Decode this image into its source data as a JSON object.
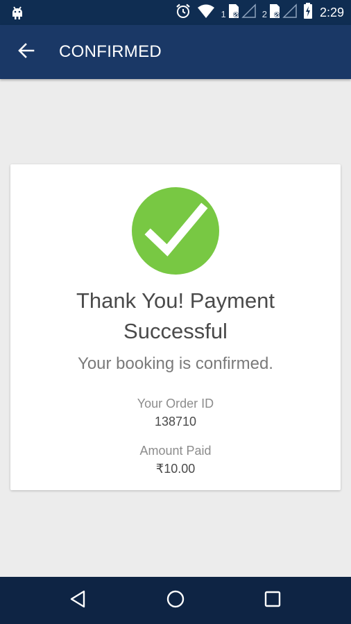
{
  "status_bar": {
    "time": "2:29",
    "sim1_label": "1",
    "sim2_label": "2",
    "icons": [
      "android-notification-icon",
      "alarm-icon",
      "wifi-icon",
      "sim-card-icon",
      "signal-icon",
      "battery-charging-icon"
    ]
  },
  "app_bar": {
    "title": "CONFIRMED",
    "back_icon": "arrow-back-icon"
  },
  "confirmation": {
    "icon": "check-circle-icon",
    "headline_line1": "Thank You! Payment",
    "headline_line2": "Successful",
    "message": "Your booking is confirmed.",
    "order_id_label": "Your Order ID",
    "order_id": "138710",
    "amount_label": "Amount Paid",
    "amount": "₹10.00"
  },
  "nav_bar": {
    "buttons": [
      "back-triangle-icon",
      "home-circle-icon",
      "recents-square-icon"
    ]
  },
  "colors": {
    "status_bar": "#0f2d52",
    "app_bar": "#1a3866",
    "nav_bar": "#0e2444",
    "background": "#ececec",
    "success_green": "#78c843"
  }
}
